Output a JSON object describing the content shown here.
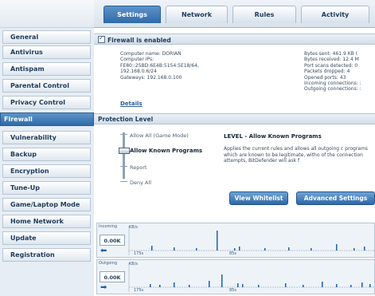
{
  "tabs": [
    {
      "label": "Settings",
      "active": true
    },
    {
      "label": "Network",
      "active": false
    },
    {
      "label": "Rules",
      "active": false
    },
    {
      "label": "Activity",
      "active": false
    }
  ],
  "sidebar": {
    "items": [
      {
        "label": "General"
      },
      {
        "label": "Antivirus"
      },
      {
        "label": "Antispam"
      },
      {
        "label": "Parental Control"
      },
      {
        "label": "Privacy Control"
      },
      {
        "label": "Firewall",
        "active": true
      },
      {
        "label": "Vulnerability"
      },
      {
        "label": "Backup"
      },
      {
        "label": "Encryption"
      },
      {
        "label": "Tune-Up"
      },
      {
        "label": "Game/Laptop Mode"
      },
      {
        "label": "Home Network"
      },
      {
        "label": "Update"
      },
      {
        "label": "Registration"
      }
    ]
  },
  "firewall": {
    "enabled_label": "Firewall is enabled",
    "enabled": true,
    "computer_info": [
      "Computer name: DORIAN",
      "Computer IPs:",
      "FE80::25BD:6E4B:5154:5E18/64,",
      "192.168.0.6/24",
      "Gateways: 192.168.0.100"
    ],
    "traffic_stats": [
      "Bytes sent: 461.9 KB (",
      "Bytes received: 12.4 M",
      "Port scans detected: 0",
      "Packets dropped: 4",
      "Opened ports: 43",
      "Incoming connections: :",
      "Outgoing connections: :"
    ],
    "details_link": "Details"
  },
  "protection": {
    "header": "Protection Level",
    "options": [
      {
        "label": "Allow All (Game Mode)"
      },
      {
        "label": "Allow Known Programs",
        "selected": true
      },
      {
        "label": "Report"
      },
      {
        "label": "Deny All"
      }
    ],
    "level_title": "LEVEL - Allow Known Programs",
    "level_desc": "Applies the current rules and allows all outgoing c programs which are known to be legitimate, witho of the connection attempts, BitDefender will ask f"
  },
  "buttons": {
    "view_whitelist": "View Whitelist",
    "advanced_settings": "Advanced Settings"
  },
  "graphs": {
    "incoming": {
      "label": "Incoming",
      "kb_unit": "KB/s",
      "value": "0.00K",
      "marker_left": "175s",
      "marker_mid": "85s"
    },
    "outgoing": {
      "label": "Outgoing",
      "kb_unit": "KB/s",
      "value": "0.00K",
      "marker_left": "175s",
      "marker_mid": "85s"
    }
  },
  "colors": {
    "accent": "#2f6aa8",
    "graph_bar": "#1f5fa8"
  }
}
